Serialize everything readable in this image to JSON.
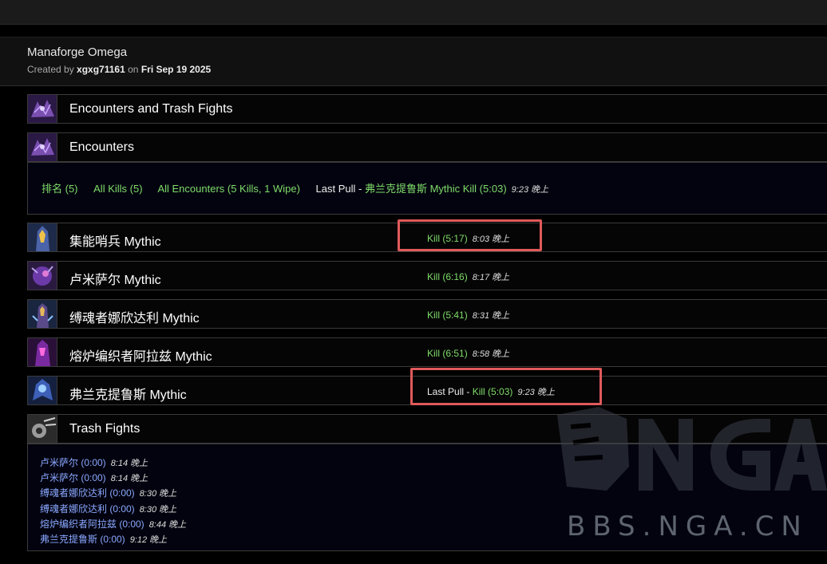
{
  "report": {
    "title": "Manaforge Omega",
    "created_by_prefix": "Created by",
    "author": "xgxg71161",
    "on_text": "on",
    "date": "Fri Sep 19 2025"
  },
  "sections": {
    "encounters_and_trash": "Encounters and Trash Fights",
    "encounters": "Encounters",
    "trash": "Trash Fights"
  },
  "filters": {
    "rankings": "排名 (5)",
    "all_kills": "All Kills (5)",
    "all_encounters": "All Encounters (5 Kills, 1 Wipe)",
    "last_pull_label": "Last Pull - ",
    "last_pull_value": "弗兰克提鲁斯 Mythic Kill (5:03)",
    "last_pull_time": "9:23 晚上"
  },
  "bosses": [
    {
      "name": "集能哨兵 Mythic",
      "last_pull": "",
      "kill": "Kill (5:17)",
      "time": "8:03 晚上"
    },
    {
      "name": "卢米萨尔 Mythic",
      "last_pull": "",
      "kill": "Kill (6:16)",
      "time": "8:17 晚上"
    },
    {
      "name": "缚魂者娜欣达利 Mythic",
      "last_pull": "",
      "kill": "Kill (5:41)",
      "time": "8:31 晚上"
    },
    {
      "name": "熔炉编织者阿拉兹 Mythic",
      "last_pull": "",
      "kill": "Kill (6:51)",
      "time": "8:58 晚上"
    },
    {
      "name": "弗兰克提鲁斯 Mythic",
      "last_pull": "Last Pull - ",
      "kill": "Kill (5:03)",
      "time": "9:23 晚上"
    }
  ],
  "trash_fights": [
    {
      "name": "卢米萨尔 (0:00)",
      "time": "8:14 晚上"
    },
    {
      "name": "卢米萨尔 (0:00)",
      "time": "8:14 晚上"
    },
    {
      "name": "缚魂者娜欣达利 (0:00)",
      "time": "8:30 晚上"
    },
    {
      "name": "缚魂者娜欣达利 (0:00)",
      "time": "8:30 晚上"
    },
    {
      "name": "熔炉编织者阿拉兹 (0:00)",
      "time": "8:44 晚上"
    },
    {
      "name": "弗兰克提鲁斯 (0:00)",
      "time": "9:12 晚上"
    }
  ],
  "watermark": "BBS.NGA.CN",
  "colors": {
    "kill": "#7fdc6a",
    "link": "#8aa8ff",
    "highlight": "#e05a5a"
  },
  "icons": [
    "raid-icon",
    "boss-portrait-icon",
    "trash-icon"
  ]
}
